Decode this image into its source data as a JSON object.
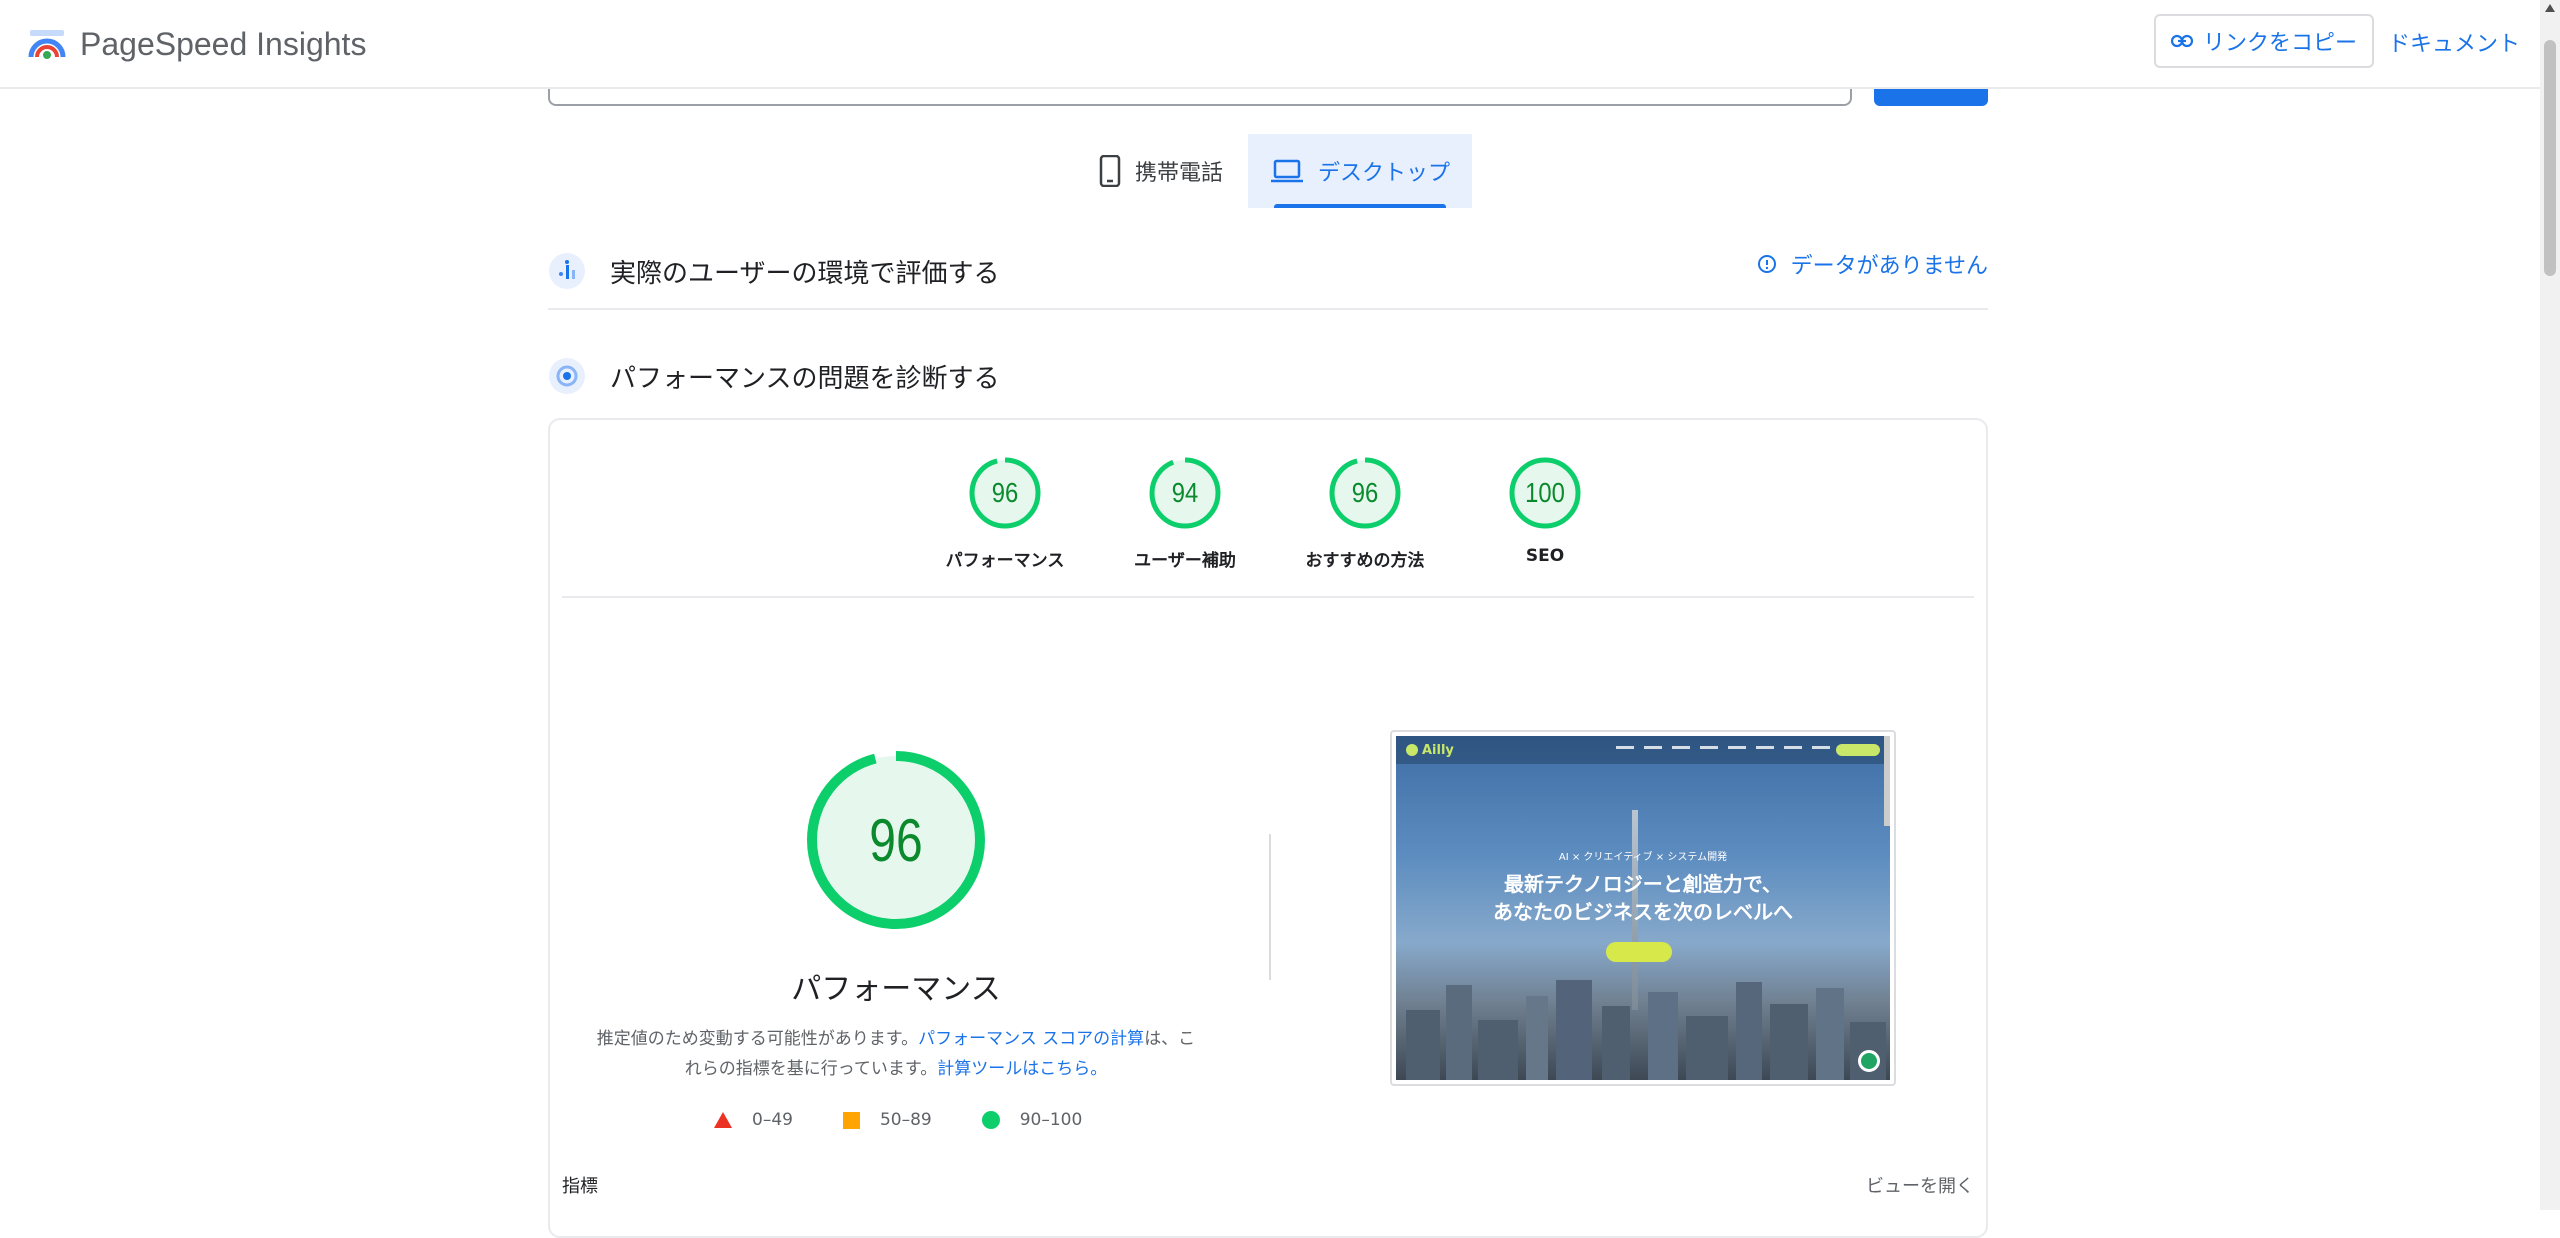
{
  "header": {
    "brand": "PageSpeed Insights",
    "copy_link": "リンクをコピー",
    "docs": "ドキュメント"
  },
  "tabs": [
    {
      "label": "携帯電話",
      "icon": "mobile-phone-icon",
      "selected": false
    },
    {
      "label": "デスクトップ",
      "icon": "laptop-icon",
      "selected": true
    }
  ],
  "field_section": {
    "title": "実際のユーザーの環境で評価する",
    "status": "データがありません"
  },
  "lab_section": {
    "title": "パフォーマンスの問題を診断する"
  },
  "scores": [
    {
      "label": "パフォーマンス",
      "value": 96
    },
    {
      "label": "ユーザー補助",
      "value": 94
    },
    {
      "label": "おすすめの方法",
      "value": 96
    },
    {
      "label": "SEO",
      "value": 100
    }
  ],
  "performance": {
    "score": 96,
    "label": "パフォーマンス",
    "desc_1": "推定値のため変動する可能性があります。",
    "desc_link_1": "パフォーマンス スコアの計算",
    "desc_2": "は、これらの指標を基に行っています。",
    "desc_link_2": "計算ツールはこちら。"
  },
  "legend": [
    {
      "shape": "triangle",
      "range": "0–49",
      "color": "#eb3223"
    },
    {
      "shape": "square",
      "range": "50–89",
      "color": "#ffa400"
    },
    {
      "shape": "circle",
      "range": "90–100",
      "color": "#0cce6b"
    }
  ],
  "screenshot": {
    "logo": "Ailly",
    "subtitle": "AI × クリエイティブ × システム開発",
    "headline_1": "最新テクノロジーと創造力で、",
    "headline_2": "あなたのビジネスを次のレベルへ"
  },
  "metrics": {
    "title": "指標",
    "expand": "ビューを開く"
  },
  "colors": {
    "accent": "#1a73e8",
    "pass": "#0cce6b",
    "pass_text": "#0a8a2d"
  }
}
